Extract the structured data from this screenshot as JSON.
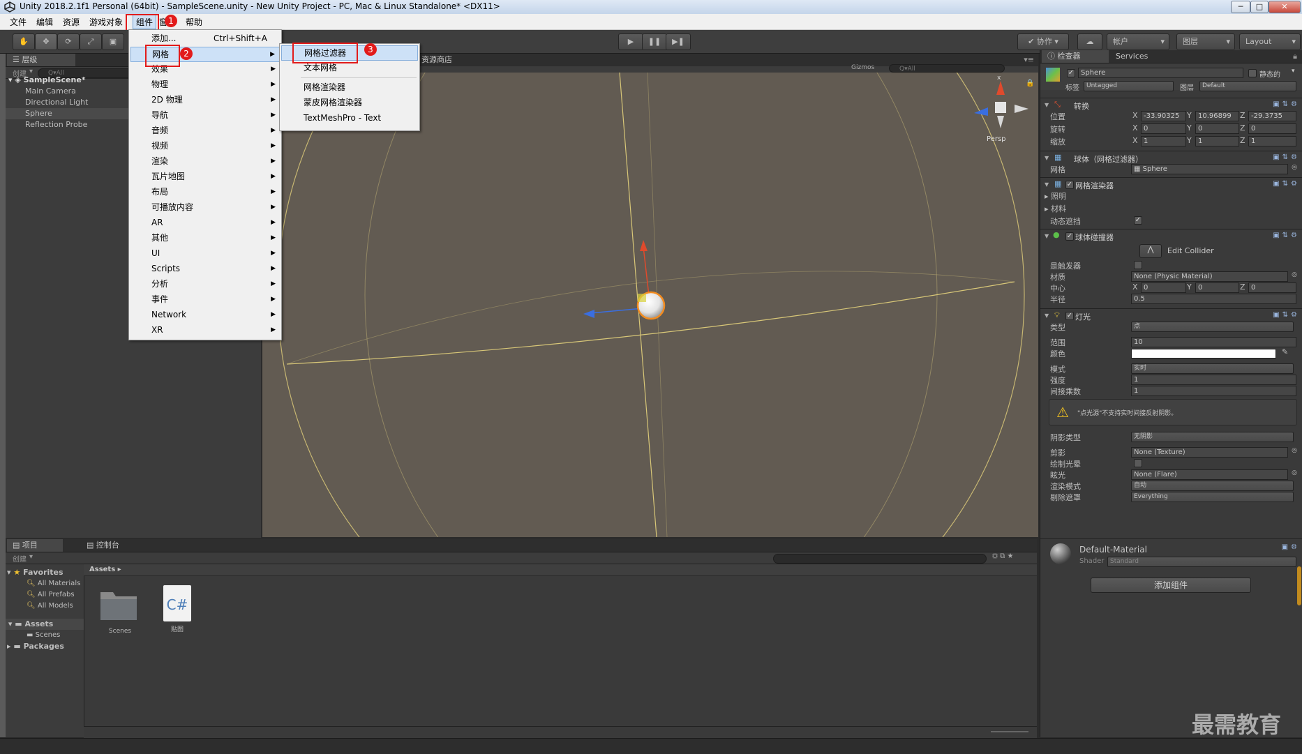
{
  "window": {
    "title": "Unity 2018.2.1f1 Personal (64bit) - SampleScene.unity - New Unity Project - PC, Mac & Linux Standalone* <DX11>",
    "minimize": "─",
    "maximize": "□",
    "close": "✕"
  },
  "menubar": {
    "items": [
      "文件",
      "编辑",
      "资源",
      "游戏对象",
      "组件",
      "窗口",
      "帮助"
    ]
  },
  "annotations": {
    "badge1": "1",
    "badge2": "2",
    "badge3": "3"
  },
  "component_menu": {
    "items": [
      {
        "label": "添加...",
        "shortcut": "Ctrl+Shift+A"
      },
      {
        "label": "网格"
      },
      {
        "label": "效果"
      },
      {
        "label": "物理"
      },
      {
        "label": "2D 物理"
      },
      {
        "label": "导航"
      },
      {
        "label": "音频"
      },
      {
        "label": "视频"
      },
      {
        "label": "渲染"
      },
      {
        "label": "瓦片地图"
      },
      {
        "label": "布局"
      },
      {
        "label": "可播放内容"
      },
      {
        "label": "AR"
      },
      {
        "label": "其他"
      },
      {
        "label": "UI"
      },
      {
        "label": "Scripts"
      },
      {
        "label": "分析"
      },
      {
        "label": "事件"
      },
      {
        "label": "Network"
      },
      {
        "label": "XR"
      }
    ]
  },
  "mesh_submenu": {
    "items": [
      "网格过滤器",
      "文本网格",
      "网格渲染器",
      "蒙皮网格渲染器",
      "TextMeshPro - Text"
    ]
  },
  "toolbar": {
    "collab": "协作",
    "account": "帐户",
    "layers": "图层",
    "layout": "Layout"
  },
  "hierarchy": {
    "tab": "层级",
    "create": "创建",
    "search_placeholder": "Q▾All",
    "scene": "SampleScene*",
    "items": [
      "Main Camera",
      "Directional Light",
      "Sphere",
      "Reflection Probe"
    ]
  },
  "scene": {
    "asset_store_tab": "资源商店",
    "gizmos": "Gizmos",
    "search": "Q▾All",
    "persp": "Persp",
    "gizmo_x": "x"
  },
  "project": {
    "tab": "项目",
    "console_tab": "控制台",
    "create": "创建",
    "favorites": "Favorites",
    "fav_items": [
      "All Materials",
      "All Prefabs",
      "All Models"
    ],
    "assets": "Assets",
    "asset_children": [
      "Scenes"
    ],
    "packages": "Packages",
    "breadcrumb": "Assets",
    "files": [
      {
        "name": "Scenes",
        "type": "folder"
      },
      {
        "name": "贴图",
        "type": "script",
        "glyph": "C#"
      }
    ]
  },
  "inspector": {
    "tab": "检查器",
    "services_tab": "Services",
    "object_name": "Sphere",
    "static_label": "静态的",
    "tag_label": "标签",
    "tag_value": "Untagged",
    "layer_label": "图层",
    "layer_value": "Default",
    "transform": {
      "title": "转换",
      "position_label": "位置",
      "position": [
        "-33.90325",
        "10.96899",
        "-29.3735"
      ],
      "rotation_label": "旋转",
      "rotation": [
        "0",
        "0",
        "0"
      ],
      "scale_label": "缩放",
      "scale": [
        "1",
        "1",
        "1"
      ],
      "axis_x": "X",
      "axis_y": "Y",
      "axis_z": "Z"
    },
    "mesh_filter": {
      "title": "球体（网格过滤器）",
      "mesh_label": "网格",
      "mesh_value": "Sphere"
    },
    "mesh_renderer": {
      "title": "网格渲染器",
      "lighting": "照明",
      "materials": "材料",
      "dynamic_occluded": "动态遮挡",
      "dynamic_occluded_check": "✓"
    },
    "sphere_collider": {
      "title": "球体碰撞器",
      "edit_collider": "Edit Collider",
      "is_trigger": "是触发器",
      "material_label": "材质",
      "material_value": "None (Physic Material)",
      "center_label": "中心",
      "center": [
        "0",
        "0",
        "0"
      ],
      "radius_label": "半径",
      "radius": "0.5"
    },
    "light": {
      "title": "灯光",
      "type_label": "类型",
      "type_value": "点",
      "range_label": "范围",
      "range_value": "10",
      "color_label": "颜色",
      "color_value": "#ffffff",
      "mode_label": "模式",
      "mode_value": "实时",
      "intensity_label": "强度",
      "intensity_value": "1",
      "indirect_label": "间接乘数",
      "indirect_value": "1",
      "warning": "\"点光源\"不支持实时间接反射阴影。",
      "shadow_type_label": "阴影类型",
      "shadow_type_value": "无阴影",
      "cookie_label": "剪影",
      "cookie_value": "None (Texture)",
      "halo_label": "绘制光晕",
      "flare_label": "眩光",
      "flare_value": "None (Flare)",
      "render_mode_label": "渲染模式",
      "render_mode_value": "自动",
      "culling_label": "剔除遮罩",
      "culling_value": "Everything"
    },
    "material": {
      "name": "Default-Material",
      "shader_label": "Shader",
      "shader_value": "Standard"
    },
    "add_component": "添加组件"
  },
  "watermark": "最需教育",
  "colors": {
    "highlight_red": "#e21b1b",
    "scene_bg": "#625b52",
    "selection_blue": "#3e6fb0"
  }
}
